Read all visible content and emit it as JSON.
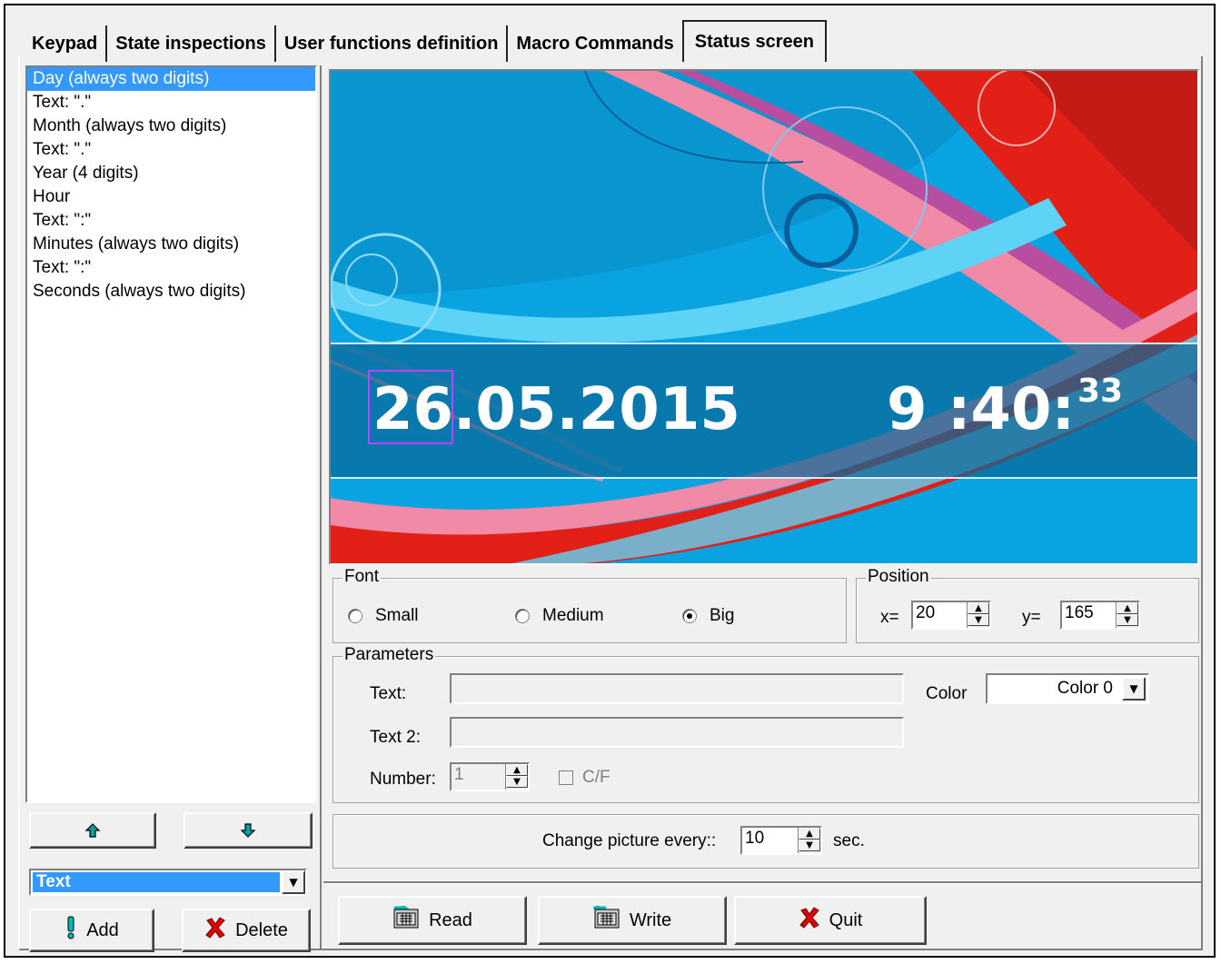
{
  "tabs": [
    "Keypad",
    "State inspections",
    "User functions definition",
    "Macro Commands",
    "Status screen"
  ],
  "active_tab": "Status screen",
  "list_items": [
    "Day (always two digits)",
    "Text: \".\"",
    "Month (always two digits)",
    "Text: \".\"",
    "Year (4 digits)",
    "Hour",
    "Text: \":\"",
    "Minutes (always two digits)",
    "Text: \":\"",
    "Seconds (always two digits)"
  ],
  "selected_item": "Day (always two digits)",
  "element_type": "Text",
  "buttons": {
    "add": "Add",
    "delete": "Delete",
    "read": "Read",
    "write": "Write",
    "quit": "Quit"
  },
  "preview": {
    "date": "26.05.2015",
    "time": "9 :40:",
    "seconds": "33"
  },
  "font": {
    "legend": "Font",
    "options": [
      "Small",
      "Medium",
      "Big"
    ],
    "selected": "Big"
  },
  "position": {
    "legend": "Position",
    "x_label": "x=",
    "x": "20",
    "y_label": "y=",
    "y": "165"
  },
  "parameters": {
    "legend": "Parameters",
    "text_label": "Text:",
    "text": "",
    "text2_label": "Text 2:",
    "text2": "",
    "number_label": "Number:",
    "number": "1",
    "cf_label": "C/F",
    "color_label": "Color",
    "color": "Color 0"
  },
  "change_picture": {
    "label": "Change picture every::",
    "value": "10",
    "unit": "sec."
  },
  "colors": {
    "selection": "#3399ff",
    "window": "#f0f0f0"
  }
}
